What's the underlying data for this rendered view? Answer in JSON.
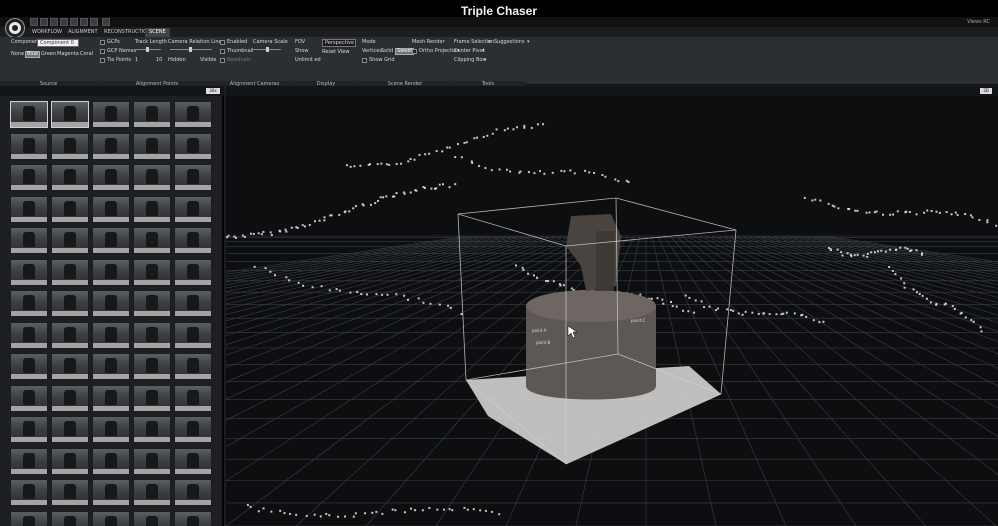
{
  "window": {
    "title": "Triple Chaser"
  },
  "topbar": {
    "right_label": "Views RC"
  },
  "tabs": [
    "WORKFLOW",
    "ALIGNMENT",
    "RECONSTRUCTION",
    "SCENE"
  ],
  "active_tab": "SCENE",
  "ribbon": {
    "source": {
      "component_label": "Component",
      "component_value": "Component 0",
      "color_modes": [
        "None",
        "Blue",
        "Green",
        "Magenta",
        "Coral"
      ],
      "selected_color_mode": "Blue",
      "group_label": "Source"
    },
    "alignment_points": {
      "checks": [
        "GCPs",
        "GCP Names",
        "Tie Points"
      ],
      "track_length_label": "Track Length",
      "track_range": [
        "1",
        "10"
      ],
      "camera_lines_label": "Camera Relation Lines",
      "hidden_label": "Hidden",
      "visible_label": "Visible",
      "group_label": "Alignment Points"
    },
    "alignment_cameras": {
      "checks": [
        "Enabled",
        "Thumbnail",
        "Residuals"
      ],
      "camera_scale_label": "Camera Scale",
      "group_label": "Alignment Cameras"
    },
    "display": {
      "fov_label": "FOV",
      "show_label": "Show",
      "unlimited_label": "Unlimit ed",
      "fov_value": "Perspective",
      "reset_view_label": "Reset View",
      "group_label": "Display"
    },
    "scene_render": {
      "mode_label": "Mode",
      "modes": [
        "Vertices",
        "Solid",
        "Sweet"
      ],
      "active_mode": "Sweet",
      "show_grid_label": "Show Grid",
      "mesh_render_label": "Mesh Render",
      "ortho_label": "Ortho Projection",
      "group_label": "Scene Render"
    },
    "tools": {
      "frame_selection_label": "Frame Selection",
      "suggestions_label": "Suggestions",
      "center_pivot_label": "Center Pivot",
      "clipping_box_label": "Clipping Box",
      "group_label": "Tools"
    }
  },
  "left_panel": {
    "badge": "30x"
  },
  "viewport": {
    "badge": "3D",
    "labels": [
      "point A",
      "point B",
      "point C"
    ],
    "colors": {
      "grid": "#3a3e44",
      "box": "#d0d0d0",
      "points": "#e8e8e8",
      "object": "#5e5854"
    }
  }
}
